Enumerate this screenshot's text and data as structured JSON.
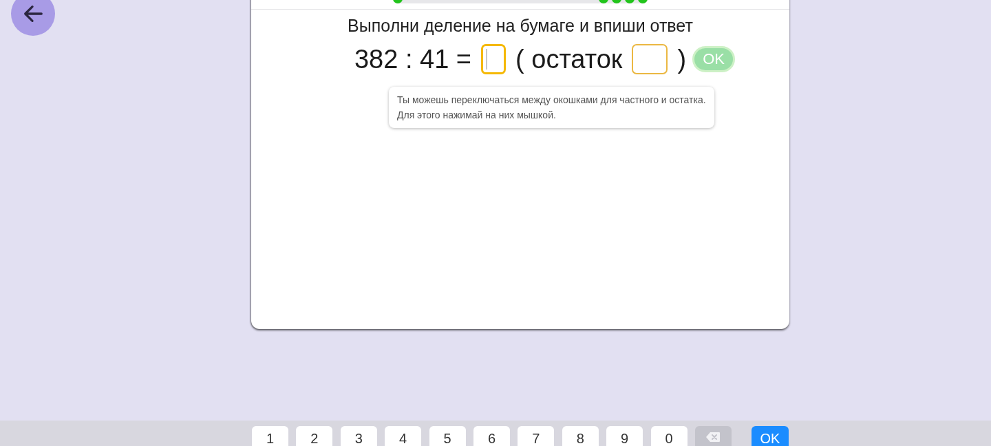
{
  "task": {
    "title": "Выполни деление на бумаге и впиши ответ"
  },
  "equation": {
    "expression": "382 : 41 =",
    "quotient_field": {
      "selected": true
    },
    "remainder_label": "( остаток",
    "remainder_field": {
      "selected": false
    },
    "closing": ")"
  },
  "ok_button": {
    "label": "OK",
    "disabled": true
  },
  "hint": "Ты можешь переключаться между окошками для частного и остатка.\nДля этого нажимай на них мышкой.",
  "keypad": {
    "keys": [
      {
        "kind": "digit",
        "label": "1"
      },
      {
        "kind": "digit",
        "label": "2"
      },
      {
        "kind": "digit",
        "label": "3"
      },
      {
        "kind": "digit",
        "label": "4"
      },
      {
        "kind": "digit",
        "label": "5"
      },
      {
        "kind": "digit",
        "label": "6"
      },
      {
        "kind": "digit",
        "label": "7"
      },
      {
        "kind": "digit",
        "label": "8"
      },
      {
        "kind": "digit",
        "label": "9"
      },
      {
        "kind": "digit",
        "label": "0"
      },
      {
        "kind": "backspace"
      },
      {
        "kind": "confirm",
        "label": "OK"
      }
    ]
  }
}
